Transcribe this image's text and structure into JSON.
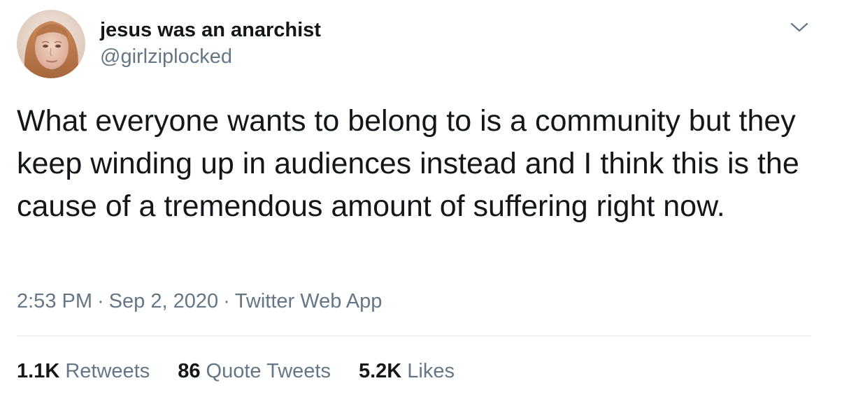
{
  "user": {
    "display_name": "jesus was an anarchist",
    "handle": "@girlziplocked"
  },
  "tweet": {
    "text": "What everyone wants to belong to is a community but they keep winding up in audiences instead and I think this is the cause of a tremendous amount of suffering right now.",
    "time": "2:53 PM",
    "separator": "·",
    "date": "Sep 2, 2020",
    "source": "Twitter Web App"
  },
  "stats": {
    "retweets": {
      "count": "1.1K",
      "label": "Retweets"
    },
    "quotes": {
      "count": "86",
      "label": "Quote Tweets"
    },
    "likes": {
      "count": "5.2K",
      "label": "Likes"
    }
  },
  "icons": {
    "menu": "chevron-down-icon",
    "avatar": "profile-photo"
  },
  "colors": {
    "text": "#14171a",
    "muted": "#657786",
    "divider": "#e1e8ed"
  }
}
